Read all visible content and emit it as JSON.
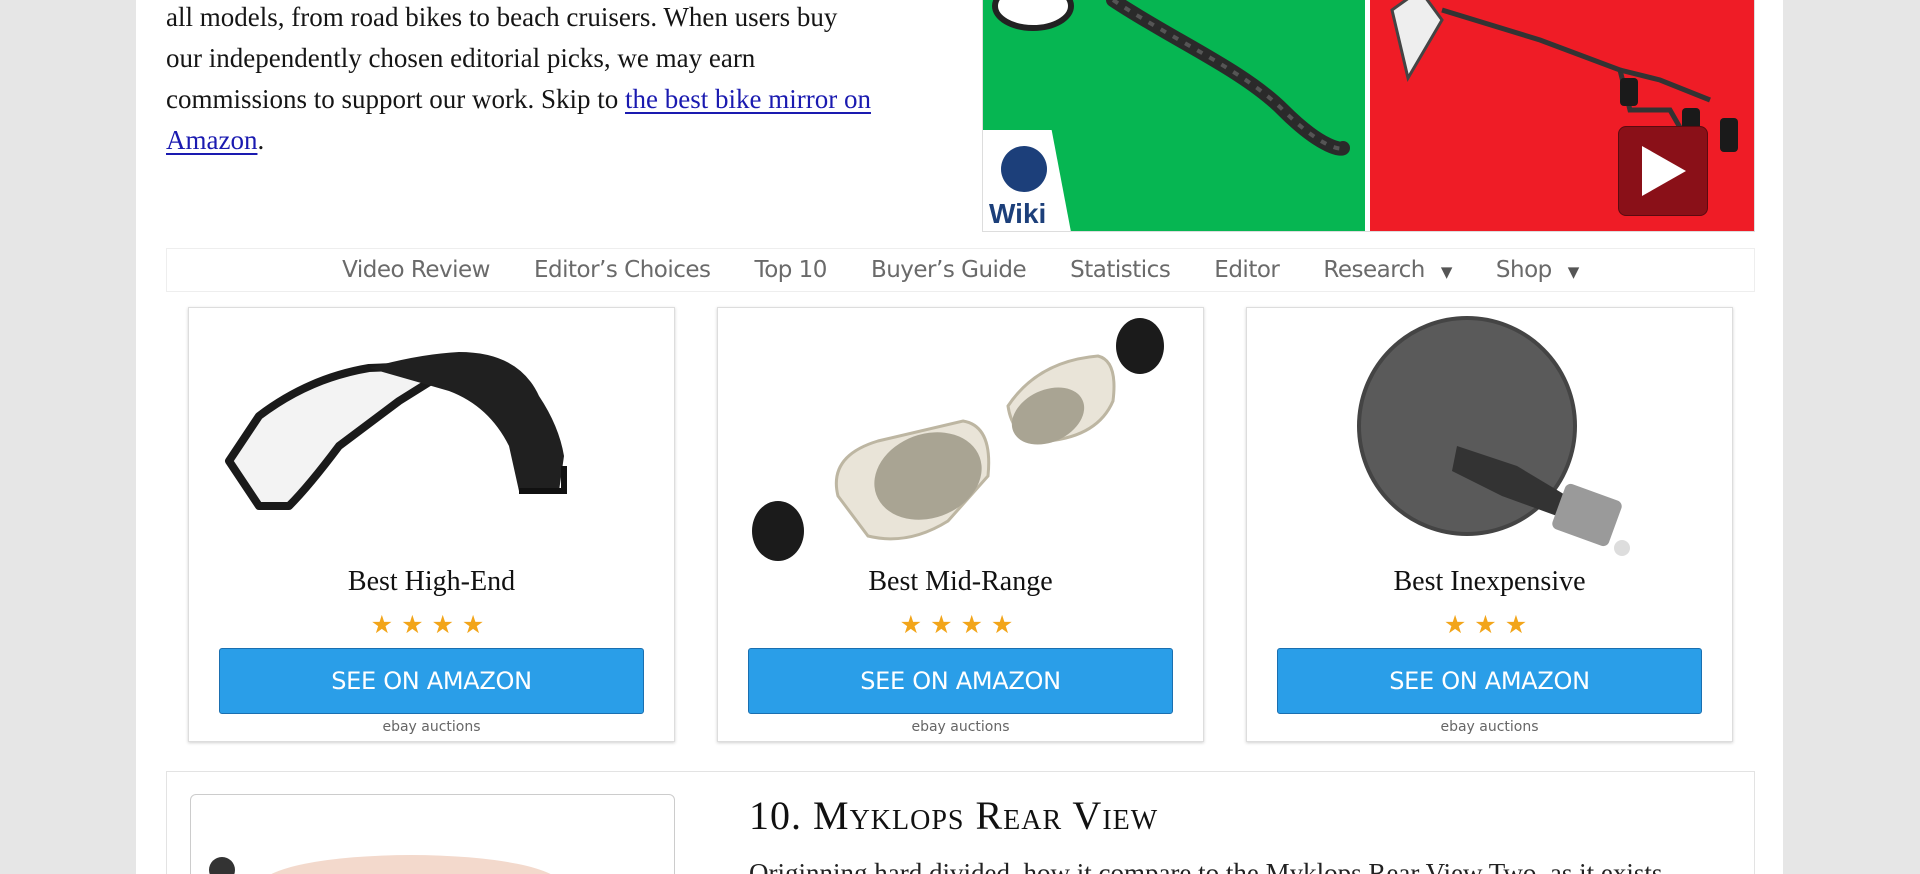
{
  "intro": {
    "line1": "all models, from road bikes to beach cruisers. When users buy",
    "line2": "our independently chosen editorial picks, we may earn",
    "line3_prefix": "commissions to support our work. Skip to ",
    "link_text": "the best bike mirror on Amazon",
    "suffix": "."
  },
  "video": {
    "badge_text": "Wiki",
    "play_icon": "play-icon",
    "colors": {
      "left": "#06b652",
      "right": "#ef1c26",
      "play": "#8a1018"
    }
  },
  "nav": {
    "items": [
      {
        "label": "Video Review"
      },
      {
        "label": "Editor’s Choices"
      },
      {
        "label": "Top 10"
      },
      {
        "label": "Buyer’s Guide"
      },
      {
        "label": "Statistics"
      },
      {
        "label": "Editor"
      },
      {
        "label": "Research",
        "caret": "▼"
      },
      {
        "label": "Shop",
        "caret": "▼"
      }
    ]
  },
  "cards": [
    {
      "title": "Best High-End",
      "rating": 4,
      "stars": "★★★★",
      "button": "SEE ON AMAZON",
      "auctions": "ebay auctions"
    },
    {
      "title": "Best Mid-Range",
      "rating": 4,
      "stars": "★★★★",
      "button": "SEE ON AMAZON",
      "auctions": "ebay auctions"
    },
    {
      "title": "Best Inexpensive",
      "rating": 3,
      "stars": "★★★",
      "button": "SEE ON AMAZON",
      "auctions": "ebay auctions"
    }
  ],
  "review": {
    "heading": "10. Myklops Rear View",
    "excerpt": "Originning hard divided, how it compare to the Myklops Rear View Two, as it exists"
  },
  "colors": {
    "accent_button": "#2a9ee8",
    "star": "#f2a51a",
    "link": "#1a1ab0"
  }
}
